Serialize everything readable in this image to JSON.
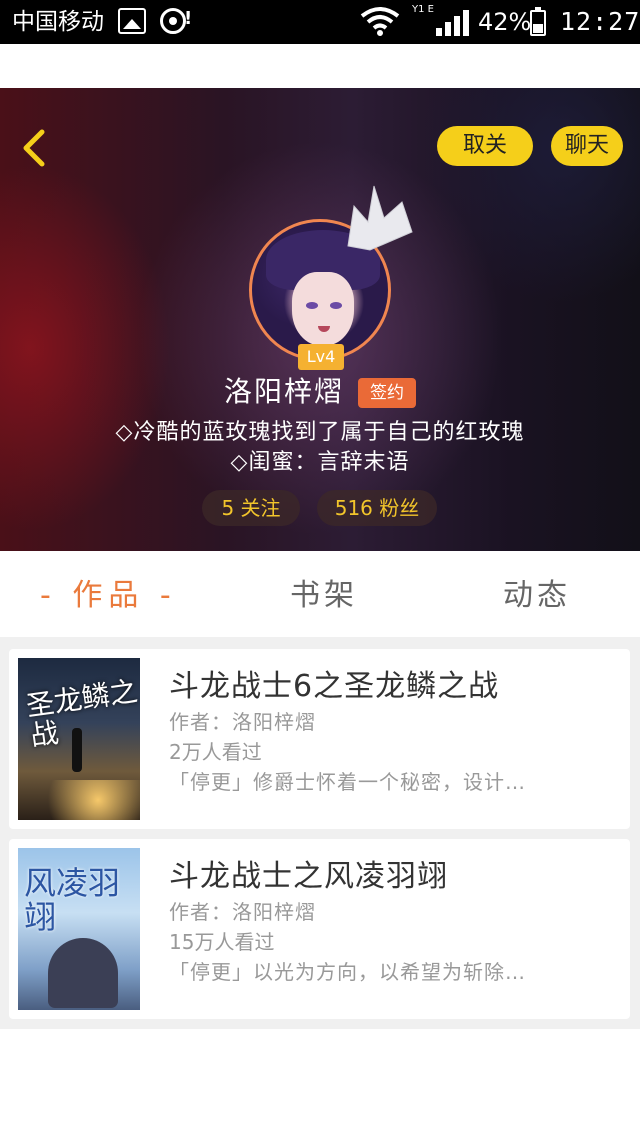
{
  "status_bar": {
    "carrier": "中国移动",
    "network_label": "Y1 E",
    "battery": "42%",
    "time": "12:27"
  },
  "header": {
    "back_icon": "chevron-left-icon",
    "unfollow_label": "取关",
    "chat_label": "聊天"
  },
  "profile": {
    "avatar_icon": "user-avatar",
    "crown_icon": "crown-icon",
    "level": "Lv4",
    "name": "洛阳梓熠",
    "signed_badge": "签约",
    "bio_line1": "◇冷酷的蓝玫瑰找到了属于自己的红玫瑰",
    "bio_line2": "◇闺蜜：言辞末语",
    "following": "5  关注",
    "fans": "516  粉丝"
  },
  "tabs": {
    "works": "- 作品 -",
    "shelf": "书架",
    "feed": "动态"
  },
  "books": [
    {
      "title": "斗龙战士6之圣龙鳞之战",
      "author": "作者：洛阳梓熠",
      "reads": "2万人看过",
      "desc": "「停更」修爵士怀着一个秘密，设计…",
      "cover_text": "圣龙鳞之战"
    },
    {
      "title": "斗龙战士之风凌羽翊",
      "author": "作者：洛阳梓熠",
      "reads": "15万人看过",
      "desc": "「停更」以光为方向，以希望为斩除…",
      "cover_text": "风凌羽翊"
    }
  ],
  "colors": {
    "accent_yellow": "#f5cf1a",
    "accent_orange": "#ea7a3c",
    "stat_text": "#f2c52b"
  }
}
